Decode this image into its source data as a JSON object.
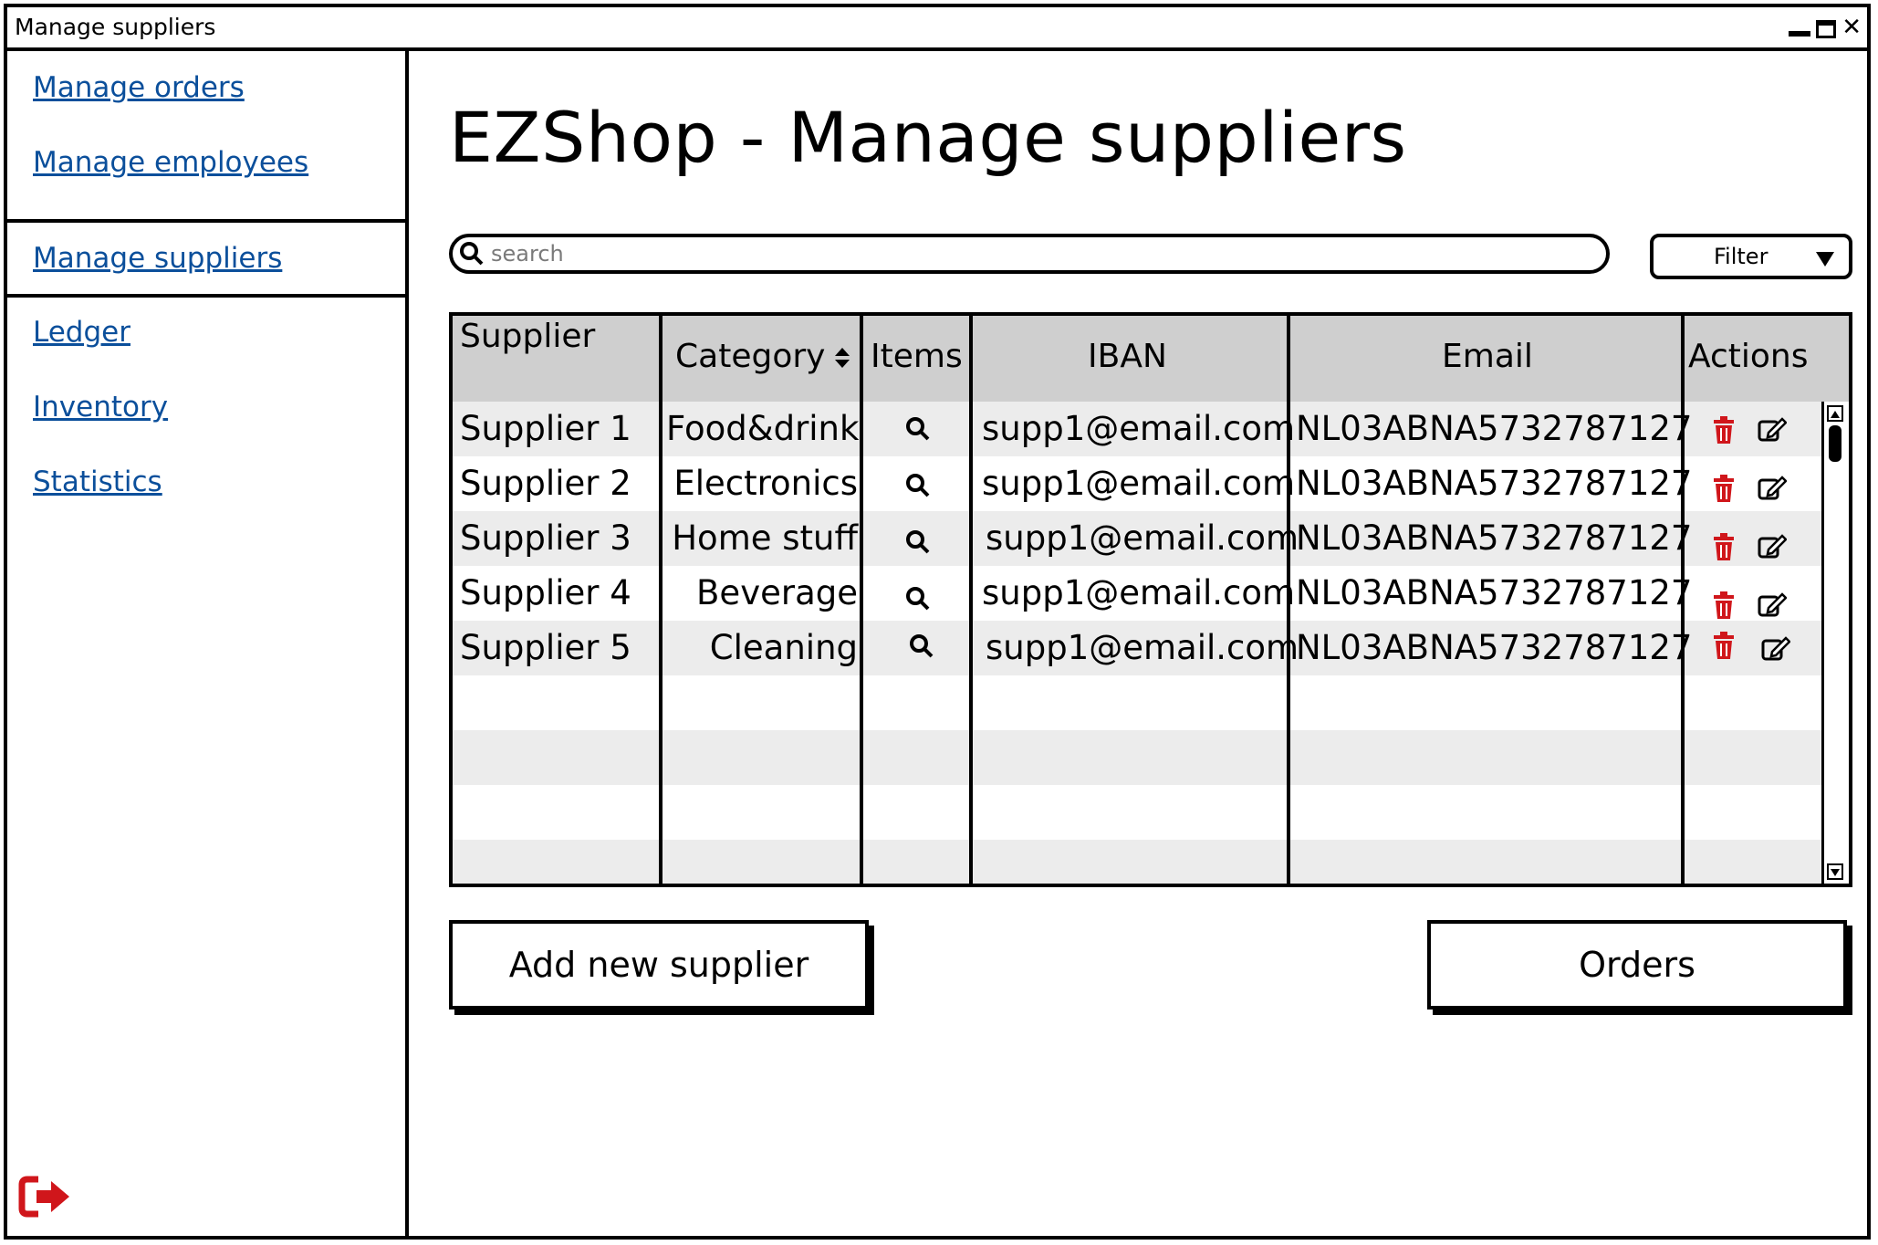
{
  "window": {
    "title": "Manage suppliers"
  },
  "sidebar": {
    "items": [
      {
        "label": "Manage orders"
      },
      {
        "label": "Manage employees"
      },
      {
        "label": "Manage suppliers"
      },
      {
        "label": "Ledger"
      },
      {
        "label": "Inventory"
      },
      {
        "label": "Statistics"
      }
    ],
    "selected": "Manage suppliers",
    "logout_icon": "sign-out-icon"
  },
  "main": {
    "title": "EZShop - Manage suppliers",
    "search": {
      "placeholder": "search",
      "value": ""
    },
    "filter": {
      "label": "Filter"
    }
  },
  "table": {
    "columns": [
      "Supplier",
      "Category",
      "Items",
      "IBAN",
      "Email",
      "Actions"
    ],
    "rows": [
      {
        "supplier": "Supplier 1",
        "category": "Food&drink",
        "iban": "supp1@email.com",
        "email": "NL03ABNA5732787127"
      },
      {
        "supplier": "Supplier 2",
        "category": "Electronics",
        "iban": "supp1@email.com",
        "email": "NL03ABNA5732787127"
      },
      {
        "supplier": "Supplier 3",
        "category": "Home stuff",
        "iban": "supp1@email.com",
        "email": "NL03ABNA5732787127"
      },
      {
        "supplier": "Supplier 4",
        "category": "Beverage",
        "iban": "supp1@email.com",
        "email": "NL03ABNA5732787127"
      },
      {
        "supplier": "Supplier 5",
        "category": "Cleaning",
        "iban": "supp1@email.com",
        "email": "NL03ABNA5732787127"
      }
    ]
  },
  "buttons": {
    "add_supplier": "Add new supplier",
    "orders": "Orders"
  },
  "colors": {
    "link": "#0b4f9b",
    "delete": "#d0161b",
    "header_bg": "#cfcfcf",
    "alt_row": "#ececec"
  }
}
